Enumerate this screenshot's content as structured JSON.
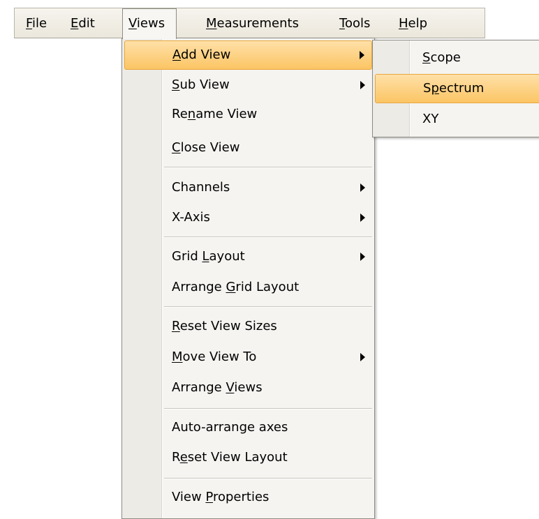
{
  "menubar": {
    "items": [
      {
        "label": "File",
        "ul": "F",
        "rest": "ile"
      },
      {
        "label": "Edit",
        "ul": "E",
        "rest": "dit"
      },
      {
        "label": "Views",
        "ul": "V",
        "rest": "iews"
      },
      {
        "label": "Measurements",
        "ul": "M",
        "rest": "easurements"
      },
      {
        "label": "Tools",
        "ul": "T",
        "rest": "ools"
      },
      {
        "label": "Help",
        "ul": "H",
        "rest": "elp"
      }
    ]
  },
  "views_menu": {
    "items": [
      {
        "pre": "",
        "ul": "A",
        "post": "dd View",
        "submenu": true
      },
      {
        "pre": "",
        "ul": "S",
        "post": "ub View",
        "submenu": true
      },
      {
        "pre": "Re",
        "ul": "n",
        "post": "ame View",
        "submenu": false
      },
      {
        "pre": "",
        "ul": "C",
        "post": "lose View",
        "submenu": false
      },
      {
        "pre": "Channels",
        "ul": "",
        "post": "",
        "submenu": true
      },
      {
        "pre": "X-Axis",
        "ul": "",
        "post": "",
        "submenu": true
      },
      {
        "pre": "Grid ",
        "ul": "L",
        "post": "ayout",
        "submenu": true
      },
      {
        "pre": "Arrange ",
        "ul": "G",
        "post": "rid Layout",
        "submenu": false
      },
      {
        "pre": "",
        "ul": "R",
        "post": "eset View Sizes",
        "submenu": false
      },
      {
        "pre": "",
        "ul": "M",
        "post": "ove View To",
        "submenu": true
      },
      {
        "pre": "Arrange ",
        "ul": "V",
        "post": "iews",
        "submenu": false
      },
      {
        "pre": "Auto-arrange axes",
        "ul": "",
        "post": "",
        "submenu": false
      },
      {
        "pre": "R",
        "ul": "e",
        "post": "set View Layout",
        "submenu": false
      },
      {
        "pre": "View ",
        "ul": "P",
        "post": "roperties",
        "submenu": false
      }
    ]
  },
  "add_view_submenu": {
    "items": [
      {
        "pre": "",
        "ul": "S",
        "post": "cope"
      },
      {
        "pre": "S",
        "ul": "p",
        "post": "ectrum"
      },
      {
        "pre": "XY",
        "ul": "",
        "post": ""
      }
    ]
  },
  "colors": {
    "highlight_top": "#ffe0a8",
    "highlight_bottom": "#fbc564",
    "highlight_border": "#e8a63c"
  }
}
